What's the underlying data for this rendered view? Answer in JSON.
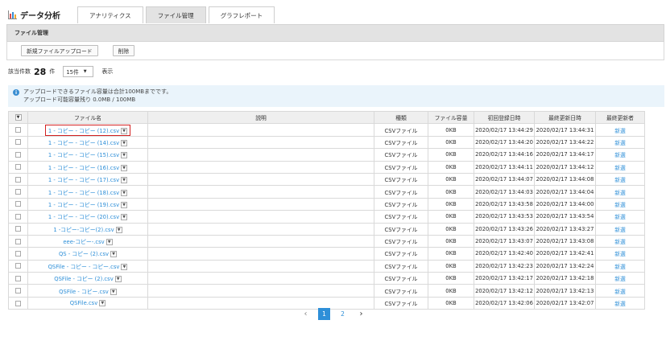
{
  "app": {
    "title": "データ分析",
    "icon": "bar-chart-icon",
    "icon_colors": [
      "#e04b4b",
      "#3a8ed2",
      "#f0a830"
    ]
  },
  "tabs": [
    {
      "label": "アナリティクス",
      "active": false
    },
    {
      "label": "ファイル管理",
      "active": true
    },
    {
      "label": "グラフレポート",
      "active": false
    }
  ],
  "panel": {
    "title": "ファイル管理"
  },
  "toolbar": {
    "upload_label": "新規ファイルアップロード",
    "delete_label": "削除"
  },
  "count": {
    "label": "該当件数",
    "number": "28",
    "unit": "件",
    "per_page": "15件",
    "display_label": "表示"
  },
  "info": {
    "line1": "アップロードできるファイル容量は合計100MBまでです。",
    "line2": "アップロード可能容量残り 0.0MB / 100MB"
  },
  "table": {
    "headers": {
      "filename": "ファイル名",
      "description": "説明",
      "type": "種類",
      "size": "ファイル容量",
      "created": "初回登録日時",
      "updated": "最終更新日時",
      "updater": "最終更新者"
    },
    "rows": [
      {
        "name": "1 - コピー - コピー (12).csv",
        "type": "CSVファイル",
        "size": "0KB",
        "created": "2020/02/17 13:44:29",
        "updated": "2020/02/17 13:44:31",
        "updater": "新選",
        "highlight": true
      },
      {
        "name": "1 - コピー - コピー (14).csv",
        "type": "CSVファイル",
        "size": "0KB",
        "created": "2020/02/17 13:44:20",
        "updated": "2020/02/17 13:44:22",
        "updater": "新選"
      },
      {
        "name": "1 - コピー - コピー (15).csv",
        "type": "CSVファイル",
        "size": "0KB",
        "created": "2020/02/17 13:44:16",
        "updated": "2020/02/17 13:44:17",
        "updater": "新選"
      },
      {
        "name": "1 - コピー - コピー (16).csv",
        "type": "CSVファイル",
        "size": "0KB",
        "created": "2020/02/17 13:44:11",
        "updated": "2020/02/17 13:44:12",
        "updater": "新選"
      },
      {
        "name": "1 - コピー - コピー (17).csv",
        "type": "CSVファイル",
        "size": "0KB",
        "created": "2020/02/17 13:44:07",
        "updated": "2020/02/17 13:44:08",
        "updater": "新選"
      },
      {
        "name": "1 - コピー - コピー (18).csv",
        "type": "CSVファイル",
        "size": "0KB",
        "created": "2020/02/17 13:44:03",
        "updated": "2020/02/17 13:44:04",
        "updater": "新選"
      },
      {
        "name": "1 - コピー - コピー (19).csv",
        "type": "CSVファイル",
        "size": "0KB",
        "created": "2020/02/17 13:43:58",
        "updated": "2020/02/17 13:44:00",
        "updater": "新選"
      },
      {
        "name": "1 - コピー - コピー (20).csv",
        "type": "CSVファイル",
        "size": "0KB",
        "created": "2020/02/17 13:43:53",
        "updated": "2020/02/17 13:43:54",
        "updater": "新選"
      },
      {
        "name": "1 -コピー-コピー(2).csv",
        "type": "CSVファイル",
        "size": "0KB",
        "created": "2020/02/17 13:43:26",
        "updated": "2020/02/17 13:43:27",
        "updater": "新選"
      },
      {
        "name": "eee-コピー-.csv",
        "type": "CSVファイル",
        "size": "0KB",
        "created": "2020/02/17 13:43:07",
        "updated": "2020/02/17 13:43:08",
        "updater": "新選"
      },
      {
        "name": "QS - コピー (2).csv",
        "type": "CSVファイル",
        "size": "0KB",
        "created": "2020/02/17 13:42:40",
        "updated": "2020/02/17 13:42:41",
        "updater": "新選"
      },
      {
        "name": "QSFile - コピー - コピー.csv",
        "type": "CSVファイル",
        "size": "0KB",
        "created": "2020/02/17 13:42:23",
        "updated": "2020/02/17 13:42:24",
        "updater": "新選"
      },
      {
        "name": "QSFile - コピー (2).csv",
        "type": "CSVファイル",
        "size": "0KB",
        "created": "2020/02/17 13:42:17",
        "updated": "2020/02/17 13:42:18",
        "updater": "新選"
      },
      {
        "name": "QSFile - コピー.csv",
        "type": "CSVファイル",
        "size": "0KB",
        "created": "2020/02/17 13:42:12",
        "updated": "2020/02/17 13:42:13",
        "updater": "新選"
      },
      {
        "name": "QSFile.csv",
        "type": "CSVファイル",
        "size": "0KB",
        "created": "2020/02/17 13:42:06",
        "updated": "2020/02/17 13:42:07",
        "updater": "新選"
      }
    ]
  },
  "pagination": {
    "prev": "‹",
    "pages": [
      "1",
      "2"
    ],
    "current": "1",
    "next": "›"
  },
  "colors": {
    "accent": "#2e8fd8",
    "highlight_border": "#d32020",
    "info_bg": "#eaf4fb"
  }
}
